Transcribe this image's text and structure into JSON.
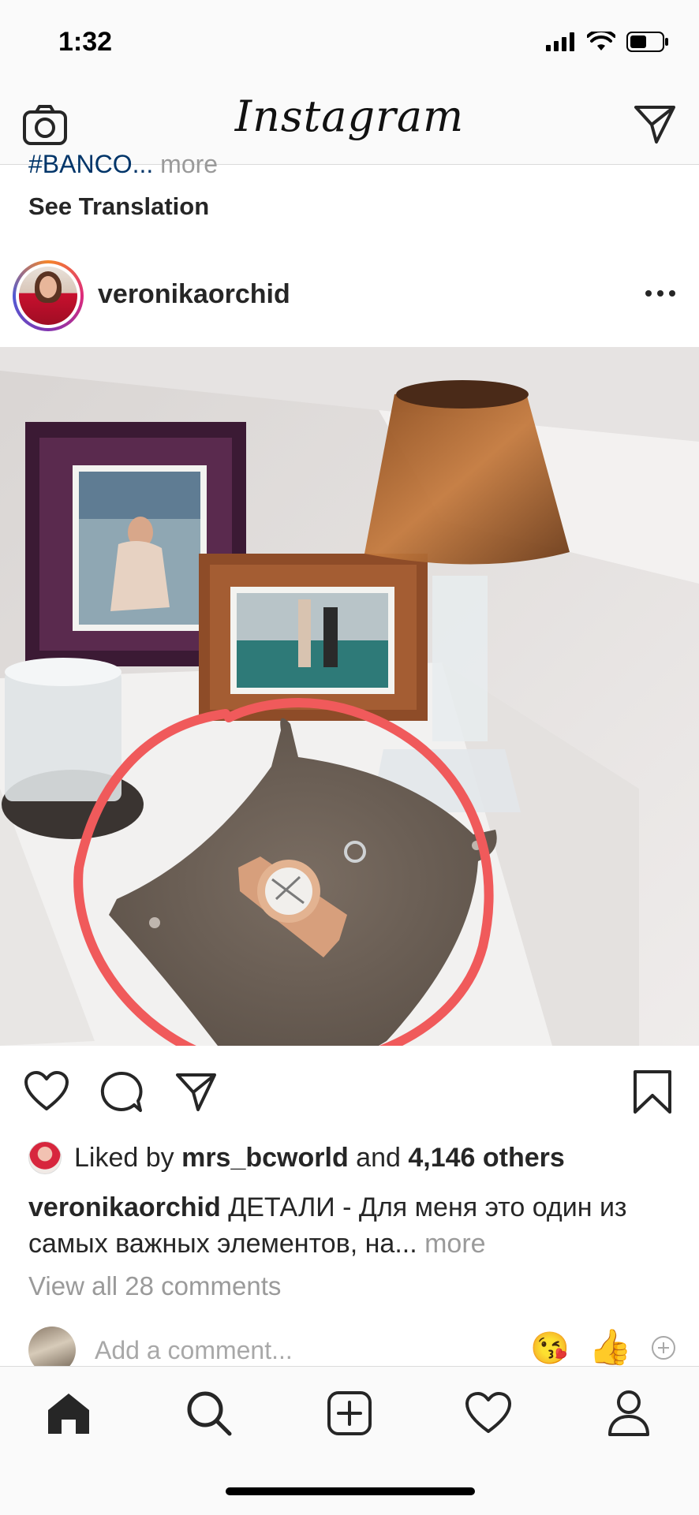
{
  "status_bar": {
    "time": "1:32"
  },
  "header": {
    "title": "Instagram",
    "camera_icon": "camera-icon",
    "direct_icon": "paper-plane-icon"
  },
  "previous_post": {
    "caption_tail_tag": "#BANCO...",
    "caption_tail_more": "more",
    "see_translation": "See Translation"
  },
  "post": {
    "username": "veronikaorchid",
    "likes": {
      "prefix": "Liked by",
      "user": "mrs_bcworld",
      "and": "and",
      "others": "4,146 others"
    },
    "caption": {
      "username": "veronikaorchid",
      "text": "ДЕТАЛИ - Для меня это один из самых важных элементов, на...",
      "more": "more"
    },
    "view_comments": "View all 28 comments",
    "add_comment_placeholder": "Add a comment...",
    "quick_emojis": [
      "😘",
      "👍"
    ]
  },
  "colors": {
    "accent_circle": "#f05a5b",
    "secondary_text": "#9a9a9a",
    "link_tag": "#003569"
  },
  "tab_bar": {
    "items": [
      "home-icon",
      "search-icon",
      "new-post-icon",
      "activity-heart-icon",
      "profile-icon"
    ]
  }
}
